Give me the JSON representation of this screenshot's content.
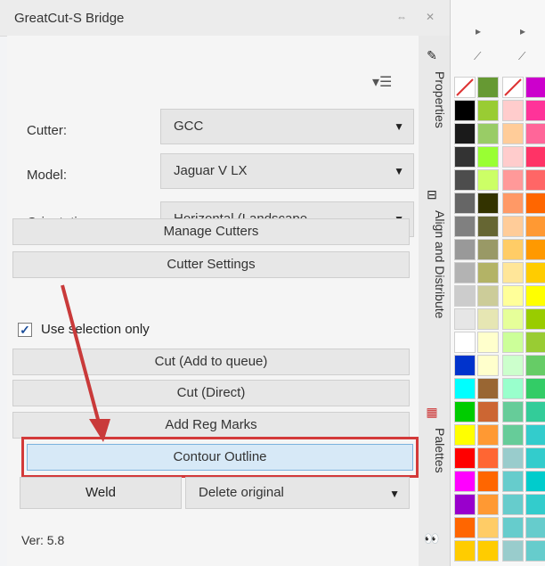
{
  "window": {
    "title": "GreatCut-S Bridge",
    "pin_icon": "pin-icon",
    "close_icon": "close-icon"
  },
  "panel": {
    "menu_icon": "panel-menu-icon",
    "fields": [
      {
        "label": "Cutter:",
        "value": "GCC"
      },
      {
        "label": "Model:",
        "value": "Jaguar V LX"
      },
      {
        "label": "Orientation:",
        "value": "Horizontal (Landscape"
      }
    ],
    "buttons": {
      "manage_cutters": "Manage Cutters",
      "cutter_settings": "Cutter Settings",
      "cut_add_queue": "Cut (Add to queue)",
      "cut_direct": "Cut (Direct)",
      "add_reg_marks": "Add Reg Marks",
      "contour_outline": "Contour Outline",
      "weld": "Weld"
    },
    "use_selection": {
      "label": "Use selection only",
      "checked": true
    },
    "delete_option": "Delete original",
    "version": "Ver: 5.8",
    "highlight_color": "#d33a3a"
  },
  "side_tabs": [
    {
      "label": "Properties"
    },
    {
      "label": "Align and Distribute"
    },
    {
      "label": "Palettes"
    }
  ],
  "palette": {
    "colors_left": [
      "none",
      "#000000",
      "#1a1a1a",
      "#333333",
      "#4d4d4d",
      "#666666",
      "#808080",
      "#999999",
      "#b3b3b3",
      "#cccccc",
      "#e6e6e6",
      "#ffffff",
      "#0033cc",
      "#00ffff",
      "#00cc00",
      "#ffff00",
      "#ff0000",
      "#ff00ff",
      "#9900cc",
      "#ff6600",
      "#ffcc00"
    ],
    "colors_mid": [
      "#669933",
      "#99cc33",
      "#99cc66",
      "#99ff33",
      "#ccff66",
      "#333300",
      "#666633",
      "#999966",
      "#b3b366",
      "#cccc99",
      "#e6e6b3",
      "#ffffcc",
      "#ffffcc",
      "#996633",
      "#cc6633",
      "#ff9933",
      "#ff6633",
      "#ff6600",
      "#ff9933",
      "#ffcc66",
      "#ffcc00"
    ],
    "colors_right": [
      "none",
      "#ffcccc",
      "#ffcc99",
      "#ffcccc",
      "#ff9999",
      "#ff9966",
      "#ffcc99",
      "#ffcc66",
      "#ffe699",
      "#ffff99",
      "#e6ff99",
      "#ccff99",
      "#ccffcc",
      "#99ffcc",
      "#66cc99",
      "#66cc99",
      "#99cccc",
      "#66cccc",
      "#66cccc",
      "#66cccc",
      "#99cccc"
    ],
    "colors_far": [
      "#cc00cc",
      "#ff3399",
      "#ff6699",
      "#ff3366",
      "#ff6666",
      "#ff6600",
      "#ff9933",
      "#ff9900",
      "#ffcc00",
      "#ffff00",
      "#99cc00",
      "#99cc33",
      "#66cc66",
      "#33cc66",
      "#33cc99",
      "#33cccc",
      "#33cccc",
      "#00cccc",
      "#33cccc",
      "#66cccc",
      "#66cccc"
    ]
  }
}
